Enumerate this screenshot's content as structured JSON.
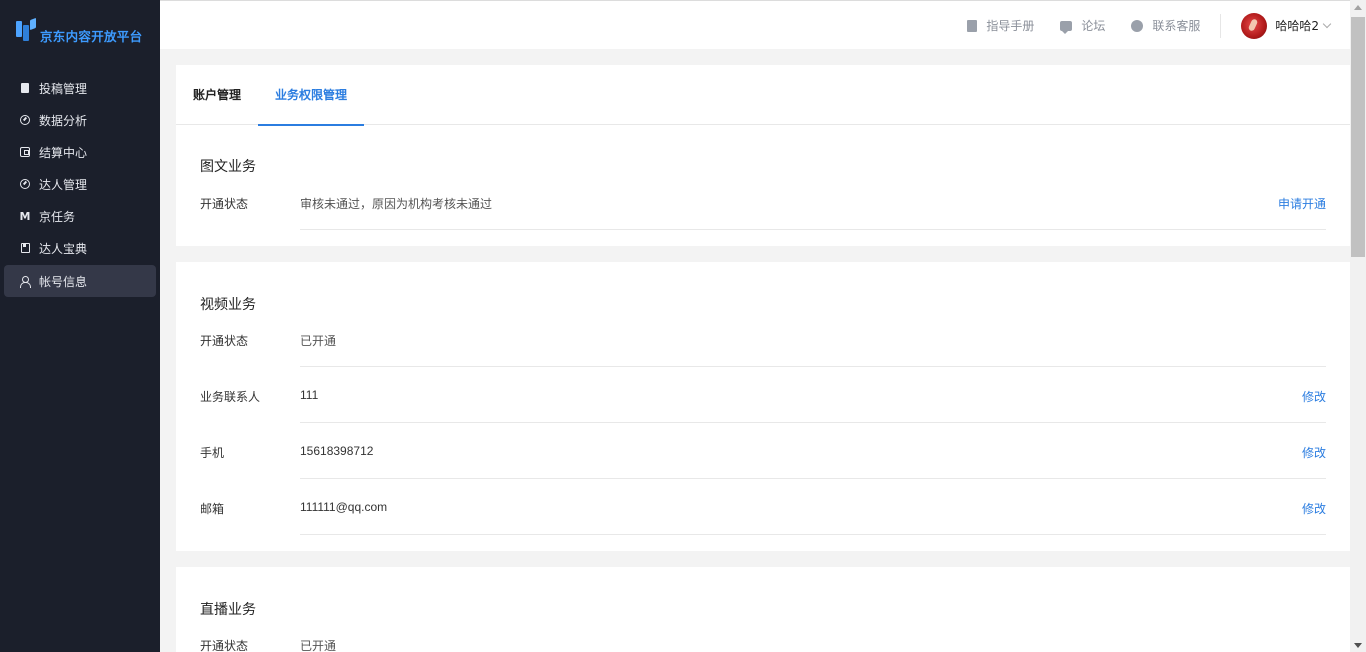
{
  "brand": {
    "logo_text": "京东内容开放平台"
  },
  "sidebar": {
    "items": [
      {
        "label": "投稿管理",
        "icon": "document-icon"
      },
      {
        "label": "数据分析",
        "icon": "analytics-icon"
      },
      {
        "label": "结算中心",
        "icon": "wallet-icon"
      },
      {
        "label": "达人管理",
        "icon": "influencer-icon"
      },
      {
        "label": "京任务",
        "icon": "task-m-icon"
      },
      {
        "label": "达人宝典",
        "icon": "handbook-icon"
      },
      {
        "label": "帐号信息",
        "icon": "user-icon",
        "active": true
      }
    ]
  },
  "header": {
    "links": [
      {
        "label": "指导手册",
        "icon": "manual-icon"
      },
      {
        "label": "论坛",
        "icon": "forum-icon"
      },
      {
        "label": "联系客服",
        "icon": "customer-service-icon"
      }
    ],
    "username": "哈哈哈2"
  },
  "tabs": [
    {
      "label": "账户管理",
      "active": false
    },
    {
      "label": "业务权限管理",
      "active": true
    }
  ],
  "sections": {
    "graphic": {
      "title": "图文业务",
      "status_label": "开通状态",
      "status_value": "审核未通过，原因为机构考核未通过",
      "action": "申请开通"
    },
    "video": {
      "title": "视频业务",
      "status_label": "开通状态",
      "status_value": "已开通",
      "contact_label": "业务联系人",
      "contact_value": "111",
      "phone_label": "手机",
      "phone_value": "15618398712",
      "email_label": "邮箱",
      "email_value": "111111@qq.com",
      "edit_label": "修改"
    },
    "live": {
      "title": "直播业务",
      "status_label": "开通状态",
      "status_value": "已开通"
    }
  },
  "colors": {
    "sidebar_bg": "#1b1f2b",
    "accent": "#2b7de0",
    "page_bg": "#f3f3f3"
  }
}
